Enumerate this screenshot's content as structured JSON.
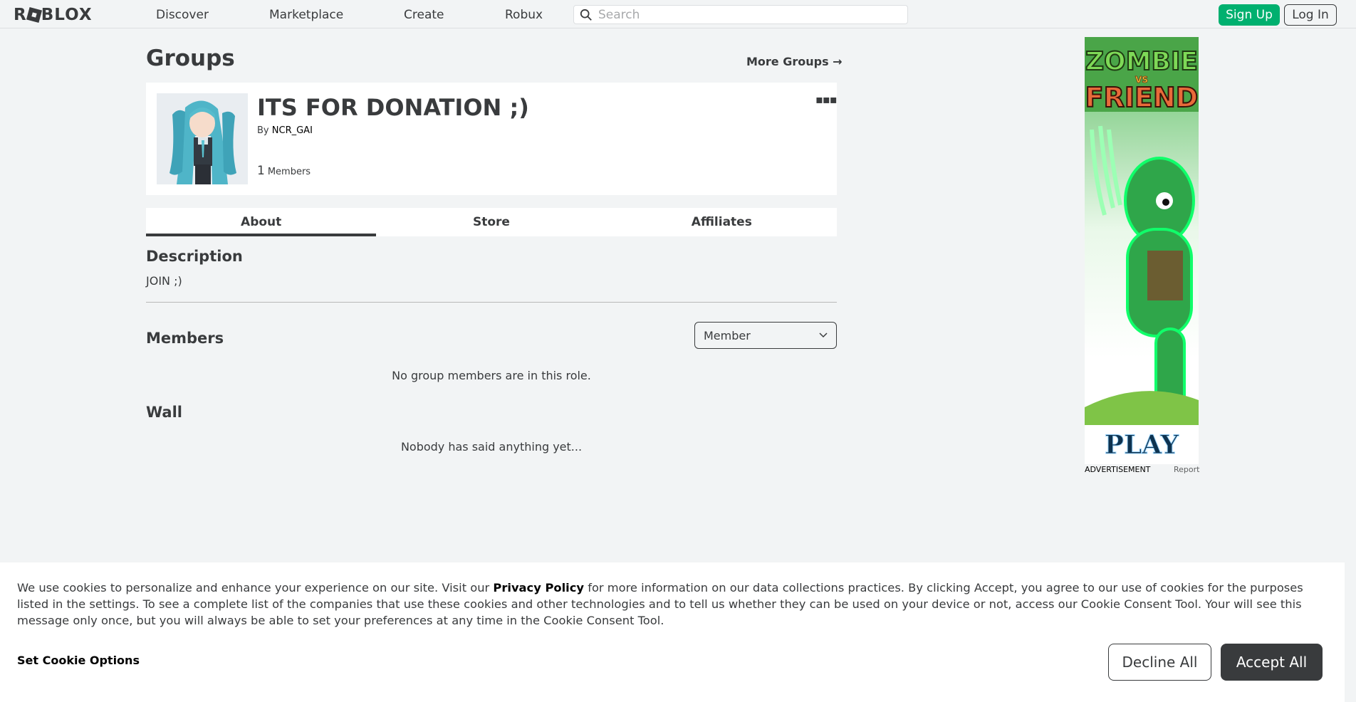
{
  "header": {
    "logo_text": "ROBLOX",
    "nav": {
      "discover": "Discover",
      "marketplace": "Marketplace",
      "create": "Create",
      "robux": "Robux"
    },
    "search_placeholder": "Search",
    "sign_up": "Sign Up",
    "log_in": "Log In"
  },
  "page": {
    "title": "Groups",
    "more_groups": "More Groups →"
  },
  "group": {
    "name": "ITS FOR DONATION ;)",
    "by_prefix": "By",
    "owner": "NCR_GAI",
    "member_count": "1",
    "member_label": "Members",
    "menu_glyph": "▪▪▪"
  },
  "tabs": {
    "about": "About",
    "store": "Store",
    "affiliates": "Affiliates"
  },
  "about": {
    "description_heading": "Description",
    "description_text": "JOIN ;)",
    "members_heading": "Members",
    "role_selected": "Member",
    "no_members_msg": "No group members are in this role.",
    "wall_heading": "Wall",
    "wall_empty_msg": "Nobody has said anything yet..."
  },
  "ad": {
    "title_line1": "ZOMBIE",
    "title_vs": "VS",
    "title_line2": "FRIEND",
    "cta": "PLAY",
    "label": "ADVERTISEMENT",
    "report": "Report"
  },
  "cookie_banner": {
    "text_before_link": "We use cookies to personalize and enhance your experience on our site. Visit our ",
    "link_text": "Privacy Policy",
    "text_after_link": " for more information on our data collections practices. By clicking Accept, you agree to our use of cookies for the purposes listed in the settings. To see a complete list of the companies that use these cookies and other technologies and to tell us whether they can be used on your device or not, access our Cookie Consent Tool. Your will see this message only once, but you will always be able to set your preferences at any time in the Cookie Consent Tool.",
    "set_options": "Set Cookie Options",
    "decline": "Decline All",
    "accept": "Accept All"
  },
  "colors": {
    "primary_text": "#393b3d",
    "background": "#f2f4f5",
    "sign_up_green": "#00b06f",
    "accept_dark": "#393b3d"
  }
}
